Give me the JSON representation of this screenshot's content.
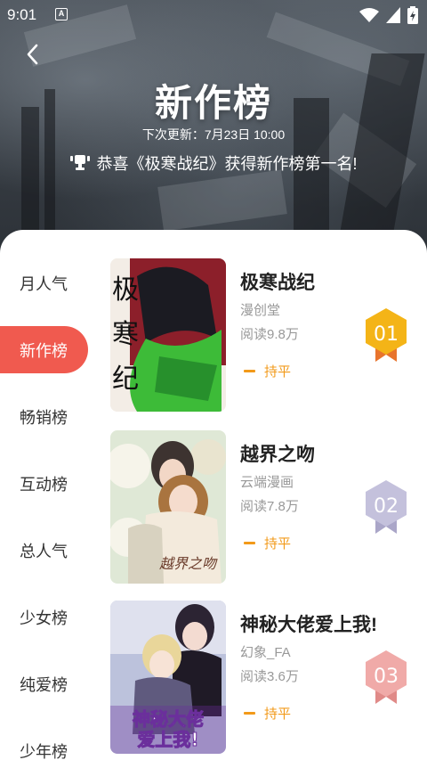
{
  "status": {
    "time": "9:01",
    "notice": "A"
  },
  "hero": {
    "title": "新作榜",
    "next_update": "下次更新：7月23日 10:00",
    "congrats": "恭喜《极寒战纪》获得新作榜第一名!"
  },
  "sidebar": {
    "items": [
      {
        "label": "月人气"
      },
      {
        "label": "新作榜"
      },
      {
        "label": "畅销榜"
      },
      {
        "label": "互动榜"
      },
      {
        "label": "总人气"
      },
      {
        "label": "少女榜"
      },
      {
        "label": "纯爱榜"
      },
      {
        "label": "少年榜"
      }
    ],
    "active": "新作榜"
  },
  "books": [
    {
      "rank": "01",
      "title": "极寒战纪",
      "author": "漫创堂",
      "reads": "阅读9.8万",
      "trend": "持平",
      "badge_color": "#f4b417",
      "ribbon_color": "#e8742d"
    },
    {
      "rank": "02",
      "title": "越界之吻",
      "author": "云端漫画",
      "reads": "阅读7.8万",
      "trend": "持平",
      "badge_color": "#c4c1dc",
      "ribbon_color": "#aaa6c8"
    },
    {
      "rank": "03",
      "title": "神秘大佬爱上我!",
      "author": "幻象_FA",
      "reads": "阅读3.6万",
      "trend": "持平",
      "badge_color": "#f0aaa8",
      "ribbon_color": "#e08a88"
    }
  ],
  "colors": {
    "accent": "#f05a4f",
    "trend": "#f29a1a"
  }
}
